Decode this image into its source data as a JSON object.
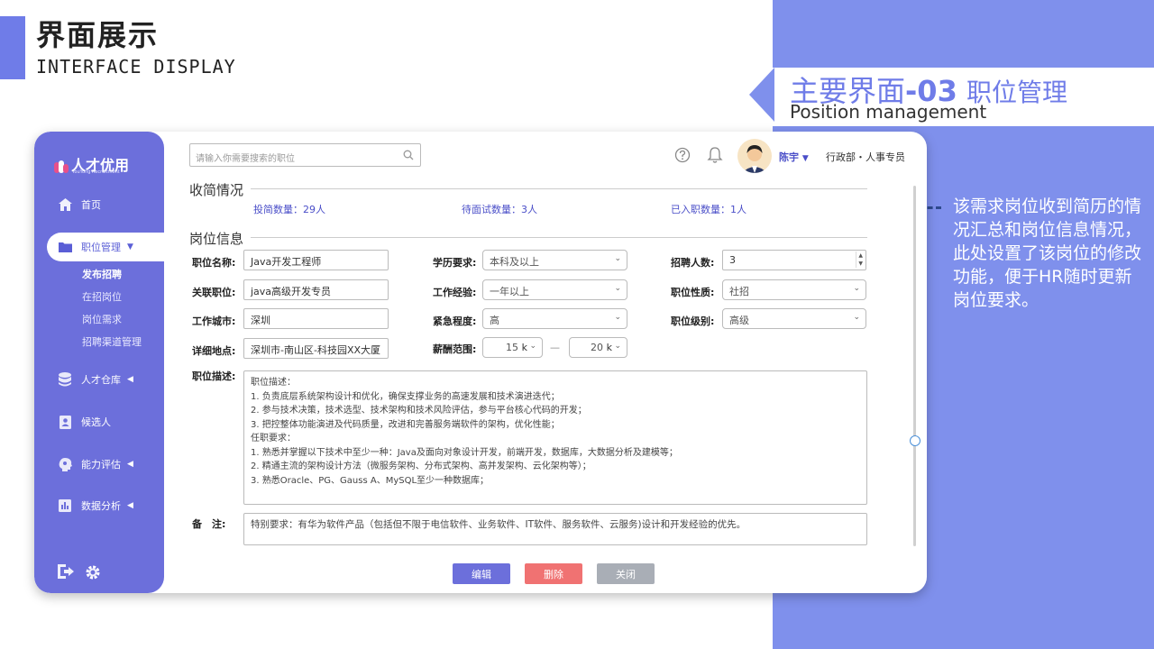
{
  "slide": {
    "title": "界面展示",
    "subtitle": "INTERFACE DISPLAY",
    "tab_title_prefix": "主要界面",
    "tab_title_num": "-03",
    "tab_title_suffix": "职位管理",
    "tab_subtitle": "Position management",
    "note": "该需求岗位收到简历的情况汇总和岗位信息情况，此处设置了该岗位的修改功能，便于HR随时更新岗位要求。",
    "colors": {
      "accent": "#6f7ce8",
      "panel": "#7f90ec",
      "sidebar": "#6c6fdb",
      "connector": "#2f4a8e"
    }
  },
  "app": {
    "logo": "人才优用",
    "logo_sub": "YouYong Recruitment",
    "nav": [
      {
        "label": "首页",
        "icon": "home-icon"
      },
      {
        "label": "职位管理",
        "icon": "folder-icon",
        "active": true
      },
      {
        "label": "人才仓库",
        "icon": "database-icon"
      },
      {
        "label": "候选人",
        "icon": "id-card-icon"
      },
      {
        "label": "能力评估",
        "icon": "brain-icon"
      },
      {
        "label": "数据分析",
        "icon": "chart-icon"
      }
    ],
    "subnav": [
      "发布招聘",
      "在招岗位",
      "岗位需求",
      "招聘渠道管理"
    ],
    "search_placeholder": "请输入你需要搜索的职位",
    "user_name": "陈宇",
    "user_dept": "行政部・人事专员"
  },
  "resume_section": {
    "title": "收简情况",
    "stats": [
      "投简数量：29人",
      "待面试数量：3人",
      "已入职数量：1人"
    ]
  },
  "post_section": {
    "title": "岗位信息",
    "fields": {
      "name_label": "职位名称:",
      "name_value": "Java开发工程师",
      "edu_label": "学历要求:",
      "edu_value": "本科及以上",
      "count_label": "招聘人数:",
      "count_value": "3",
      "related_label": "关联职位:",
      "related_value": "java高级开发专员",
      "exp_label": "工作经验:",
      "exp_value": "一年以上",
      "nature_label": "职位性质:",
      "nature_value": "社招",
      "city_label": "工作城市:",
      "city_value": "深圳",
      "urgency_label": "紧急程度:",
      "urgency_value": "高",
      "level_label": "职位级别:",
      "level_value": "高级",
      "address_label": "详细地点:",
      "address_value": "深圳市-南山区-科技园XX大厦",
      "salary_label": "薪酬范围:",
      "salary_min": "15",
      "salary_max": "20",
      "salary_unit": "k",
      "salary_sep": "—",
      "desc_label": "职位描述:",
      "remark_label": "备　注:"
    },
    "description": [
      "职位描述：",
      "1. 负责底层系统架构设计和优化，确保支撑业务的高速发展和技术演进迭代；",
      "2. 参与技术决策，技术选型、技术架构和技术风险评估，参与平台核心代码的开发；",
      "3. 把控整体功能演进及代码质量，改进和完善服务端软件的架构，优化性能；",
      "任职要求：",
      "1. 熟悉并掌握以下技术中至少一种：Java及面向对象设计开发，前端开发，数据库，大数据分析及建模等；",
      "2. 精通主流的架构设计方法（微服务架构、分布式架构、高并发架构、云化架构等）；",
      "3. 熟悉Oracle、PG、Gauss A、MySQL至少一种数据库；"
    ],
    "remark": "特别要求：有华为软件产品（包括但不限于电信软件、业务软件、IT软件、服务软件、云服务)设计和开发经验的优先。"
  },
  "buttons": {
    "edit": "编辑",
    "delete": "删除",
    "close": "关闭",
    "colors": {
      "edit": "#6c6fdb",
      "delete": "#f07272",
      "close": "#a9aeb6"
    }
  }
}
